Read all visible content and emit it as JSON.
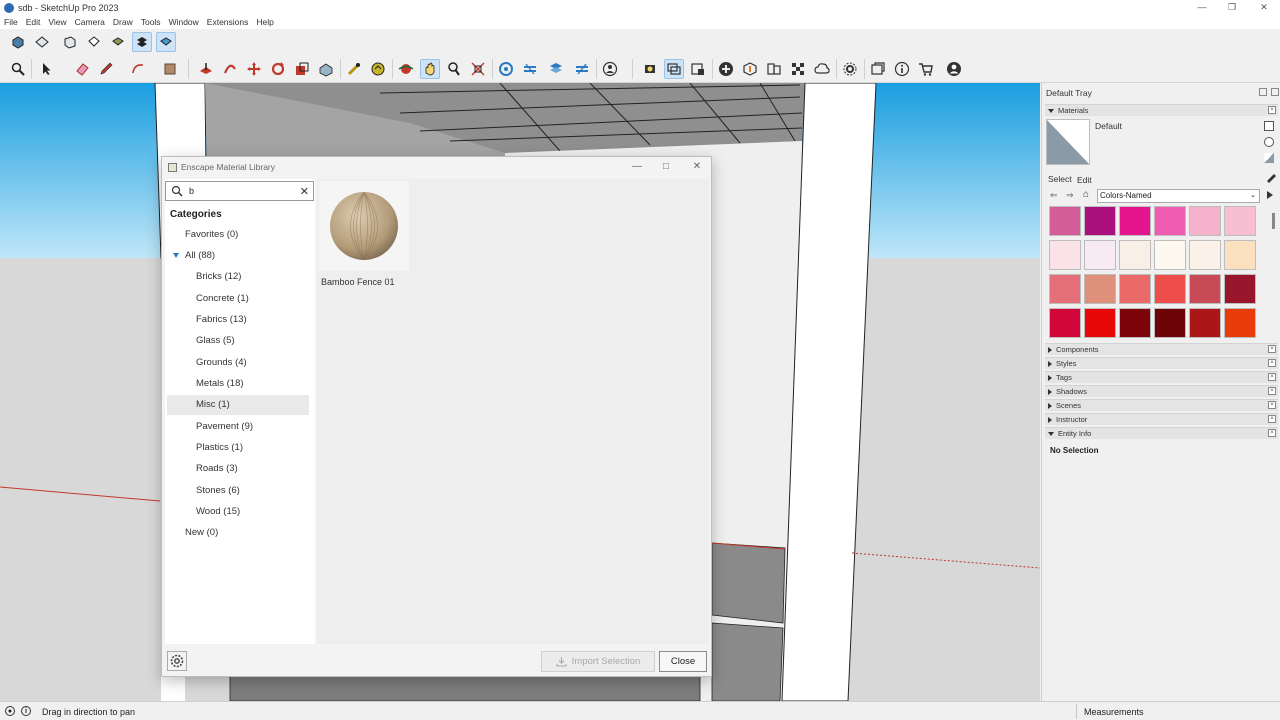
{
  "window": {
    "title": "sdb - SketchUp Pro 2023"
  },
  "menu": {
    "items": [
      "File",
      "Edit",
      "View",
      "Camera",
      "Draw",
      "Tools",
      "Window",
      "Extensions",
      "Help"
    ]
  },
  "toolbar": {
    "row1_icons": [
      "iso-view-icon",
      "top-view-icon",
      "front-view-icon",
      "right-view-icon",
      "back-view-icon",
      "left-view-icon",
      "bottom-view-icon"
    ],
    "row2_icons": [
      "search-icon",
      "select-icon",
      "eraser-icon",
      "pencil-icon",
      "arc-icon",
      "paint-bucket-icon",
      "push-pull-icon",
      "follow-me-icon",
      "move-icon",
      "rotate-icon",
      "scale-icon",
      "offset-icon",
      "tape-measure-icon",
      "protractor-icon",
      "orbit-icon",
      "pan-icon",
      "zoom-icon",
      "zoom-extents-icon",
      "section-plane-icon",
      "display-section-icon",
      "section-cut-icon",
      "section-fill-icon",
      "user-menu-icon",
      "enscape-start-icon",
      "enscape-sync-icon",
      "enscape-capture-icon",
      "add-icon",
      "upload-icon",
      "materials-icon",
      "checkerboard-icon",
      "cloud-icon",
      "settings-icon",
      "window-icon",
      "info-icon",
      "cart-icon",
      "account-icon"
    ]
  },
  "dialog": {
    "title": "Enscape Material Library",
    "search": {
      "value": "b",
      "placeholder": ""
    },
    "categories_heading": "Categories",
    "categories": [
      {
        "label": "Favorites (0)",
        "level": 1
      },
      {
        "label": "All (88)",
        "level": 1,
        "expanded": true
      },
      {
        "label": "Bricks (12)",
        "level": 2
      },
      {
        "label": "Concrete (1)",
        "level": 2
      },
      {
        "label": "Fabrics (13)",
        "level": 2
      },
      {
        "label": "Glass (5)",
        "level": 2
      },
      {
        "label": "Grounds (4)",
        "level": 2
      },
      {
        "label": "Metals (18)",
        "level": 2
      },
      {
        "label": "Misc (1)",
        "level": 2,
        "selected": true
      },
      {
        "label": "Pavement (9)",
        "level": 2
      },
      {
        "label": "Plastics (1)",
        "level": 2
      },
      {
        "label": "Roads (3)",
        "level": 2
      },
      {
        "label": "Stones (6)",
        "level": 2
      },
      {
        "label": "Wood (15)",
        "level": 2
      },
      {
        "label": "New (0)",
        "level": 1
      }
    ],
    "materials": [
      {
        "name": "Bamboo Fence 01"
      }
    ],
    "import_label": "Import Selection",
    "close_label": "Close"
  },
  "tray": {
    "title": "Default Tray",
    "materials_panel": "Materials",
    "current_material": "Default",
    "tab_select": "Select",
    "tab_edit": "Edit",
    "library": "Colors-Named",
    "swatches": [
      "#d25d97",
      "#aa0f7c",
      "#e3148c",
      "#ef5cb1",
      "#f7b2cb",
      "#f8bfd2",
      "#fbe2e6",
      "#f7eaf2",
      "#f8efe6",
      "#fdf8f0",
      "#fcf1e8",
      "#fbe0bf",
      "#e46f79",
      "#df907a",
      "#ea6a6a",
      "#ed4e4b",
      "#c84a56",
      "#98162b",
      "#d1063a",
      "#e90808",
      "#7d0408",
      "#6d0508",
      "#ab1619",
      "#e83d0a"
    ],
    "panels": [
      "Components",
      "Styles",
      "Tags",
      "Shadows",
      "Scenes",
      "Instructor",
      "Entity Info"
    ],
    "entity_info": "No Selection"
  },
  "status": {
    "text": "Drag in direction to pan",
    "measurements_label": "Measurements"
  }
}
